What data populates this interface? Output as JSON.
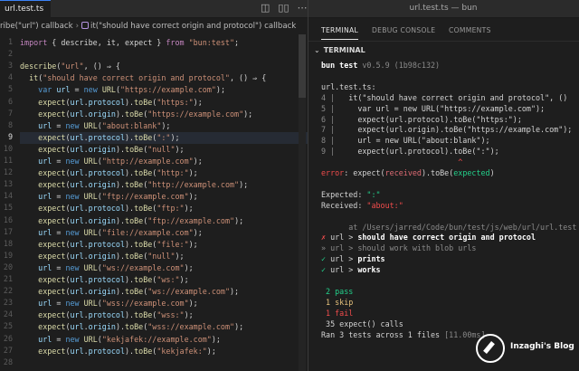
{
  "window": {
    "title": "url.test.ts — bun"
  },
  "editor": {
    "tab_label": "url.test.ts",
    "tab_actions": [
      "◫",
      "▯▯",
      "⋯"
    ],
    "breadcrumb": [
      "ribe(\"url\") callback",
      "it(\"should have correct origin and protocol\") callback"
    ],
    "active_line": 9,
    "line_numbers": [
      "1",
      "2",
      "3",
      "4",
      "5",
      "6",
      "7",
      "8",
      "9",
      "10",
      "11",
      "12",
      "13",
      "14",
      "15",
      "16",
      "17",
      "18",
      "19",
      "20",
      "21",
      "22",
      "23",
      "24",
      "25",
      "26",
      "27",
      "28"
    ],
    "lines": [
      [
        [
          "k",
          "import"
        ],
        [
          "p",
          " { describe, it, expect } "
        ],
        [
          "k",
          "from"
        ],
        [
          "p",
          " "
        ],
        [
          "s",
          "\"bun:test\""
        ],
        [
          "p",
          ";"
        ]
      ],
      [],
      [
        [
          "f",
          "describe"
        ],
        [
          "p",
          "("
        ],
        [
          "s",
          "\"url\""
        ],
        [
          "p",
          ", () ⇒ {"
        ]
      ],
      [
        [
          "p",
          "  "
        ],
        [
          "f",
          "it"
        ],
        [
          "p",
          "("
        ],
        [
          "s",
          "\"should have correct origin and protocol\""
        ],
        [
          "p",
          ", () ⇒ {"
        ]
      ],
      [
        [
          "p",
          "    "
        ],
        [
          "kb",
          "var"
        ],
        [
          "p",
          " "
        ],
        [
          "v",
          "url"
        ],
        [
          "p",
          " = "
        ],
        [
          "kb",
          "new"
        ],
        [
          "p",
          " "
        ],
        [
          "f",
          "URL"
        ],
        [
          "p",
          "("
        ],
        [
          "s",
          "\"https://example.com\""
        ],
        [
          "p",
          ");"
        ]
      ],
      [
        [
          "p",
          "    "
        ],
        [
          "f",
          "expect"
        ],
        [
          "p",
          "("
        ],
        [
          "v",
          "url"
        ],
        [
          "p",
          "."
        ],
        [
          "v",
          "protocol"
        ],
        [
          "p",
          ")."
        ],
        [
          "f",
          "toBe"
        ],
        [
          "p",
          "("
        ],
        [
          "s",
          "\"https:\""
        ],
        [
          "p",
          ");"
        ]
      ],
      [
        [
          "p",
          "    "
        ],
        [
          "f",
          "expect"
        ],
        [
          "p",
          "("
        ],
        [
          "v",
          "url"
        ],
        [
          "p",
          "."
        ],
        [
          "v",
          "origin"
        ],
        [
          "p",
          ")."
        ],
        [
          "f",
          "toBe"
        ],
        [
          "p",
          "("
        ],
        [
          "s",
          "\"https://example.com\""
        ],
        [
          "p",
          ");"
        ]
      ],
      [
        [
          "p",
          "    "
        ],
        [
          "v",
          "url"
        ],
        [
          "p",
          " = "
        ],
        [
          "kb",
          "new"
        ],
        [
          "p",
          " "
        ],
        [
          "f",
          "URL"
        ],
        [
          "p",
          "("
        ],
        [
          "s",
          "\"about:blank\""
        ],
        [
          "p",
          ");"
        ]
      ],
      [
        [
          "p",
          "    "
        ],
        [
          "f",
          "expect"
        ],
        [
          "p",
          "("
        ],
        [
          "v",
          "url"
        ],
        [
          "p",
          "."
        ],
        [
          "v",
          "protocol"
        ],
        [
          "p",
          ")."
        ],
        [
          "f",
          "toBe"
        ],
        [
          "p",
          "("
        ],
        [
          "s",
          "\":\""
        ],
        [
          "p",
          ");"
        ]
      ],
      [
        [
          "p",
          "    "
        ],
        [
          "f",
          "expect"
        ],
        [
          "p",
          "("
        ],
        [
          "v",
          "url"
        ],
        [
          "p",
          "."
        ],
        [
          "v",
          "origin"
        ],
        [
          "p",
          ")."
        ],
        [
          "f",
          "toBe"
        ],
        [
          "p",
          "("
        ],
        [
          "s",
          "\"null\""
        ],
        [
          "p",
          ");"
        ]
      ],
      [
        [
          "p",
          "    "
        ],
        [
          "v",
          "url"
        ],
        [
          "p",
          " = "
        ],
        [
          "kb",
          "new"
        ],
        [
          "p",
          " "
        ],
        [
          "f",
          "URL"
        ],
        [
          "p",
          "("
        ],
        [
          "s",
          "\"http://example.com\""
        ],
        [
          "p",
          ");"
        ]
      ],
      [
        [
          "p",
          "    "
        ],
        [
          "f",
          "expect"
        ],
        [
          "p",
          "("
        ],
        [
          "v",
          "url"
        ],
        [
          "p",
          "."
        ],
        [
          "v",
          "protocol"
        ],
        [
          "p",
          ")."
        ],
        [
          "f",
          "toBe"
        ],
        [
          "p",
          "("
        ],
        [
          "s",
          "\"http:\""
        ],
        [
          "p",
          ");"
        ]
      ],
      [
        [
          "p",
          "    "
        ],
        [
          "f",
          "expect"
        ],
        [
          "p",
          "("
        ],
        [
          "v",
          "url"
        ],
        [
          "p",
          "."
        ],
        [
          "v",
          "origin"
        ],
        [
          "p",
          ")."
        ],
        [
          "f",
          "toBe"
        ],
        [
          "p",
          "("
        ],
        [
          "s",
          "\"http://example.com\""
        ],
        [
          "p",
          ");"
        ]
      ],
      [
        [
          "p",
          "    "
        ],
        [
          "v",
          "url"
        ],
        [
          "p",
          " = "
        ],
        [
          "kb",
          "new"
        ],
        [
          "p",
          " "
        ],
        [
          "f",
          "URL"
        ],
        [
          "p",
          "("
        ],
        [
          "s",
          "\"ftp://example.com\""
        ],
        [
          "p",
          ");"
        ]
      ],
      [
        [
          "p",
          "    "
        ],
        [
          "f",
          "expect"
        ],
        [
          "p",
          "("
        ],
        [
          "v",
          "url"
        ],
        [
          "p",
          "."
        ],
        [
          "v",
          "protocol"
        ],
        [
          "p",
          ")."
        ],
        [
          "f",
          "toBe"
        ],
        [
          "p",
          "("
        ],
        [
          "s",
          "\"ftp:\""
        ],
        [
          "p",
          ");"
        ]
      ],
      [
        [
          "p",
          "    "
        ],
        [
          "f",
          "expect"
        ],
        [
          "p",
          "("
        ],
        [
          "v",
          "url"
        ],
        [
          "p",
          "."
        ],
        [
          "v",
          "origin"
        ],
        [
          "p",
          ")."
        ],
        [
          "f",
          "toBe"
        ],
        [
          "p",
          "("
        ],
        [
          "s",
          "\"ftp://example.com\""
        ],
        [
          "p",
          ");"
        ]
      ],
      [
        [
          "p",
          "    "
        ],
        [
          "v",
          "url"
        ],
        [
          "p",
          " = "
        ],
        [
          "kb",
          "new"
        ],
        [
          "p",
          " "
        ],
        [
          "f",
          "URL"
        ],
        [
          "p",
          "("
        ],
        [
          "s",
          "\"file://example.com\""
        ],
        [
          "p",
          ");"
        ]
      ],
      [
        [
          "p",
          "    "
        ],
        [
          "f",
          "expect"
        ],
        [
          "p",
          "("
        ],
        [
          "v",
          "url"
        ],
        [
          "p",
          "."
        ],
        [
          "v",
          "protocol"
        ],
        [
          "p",
          ")."
        ],
        [
          "f",
          "toBe"
        ],
        [
          "p",
          "("
        ],
        [
          "s",
          "\"file:\""
        ],
        [
          "p",
          ");"
        ]
      ],
      [
        [
          "p",
          "    "
        ],
        [
          "f",
          "expect"
        ],
        [
          "p",
          "("
        ],
        [
          "v",
          "url"
        ],
        [
          "p",
          "."
        ],
        [
          "v",
          "origin"
        ],
        [
          "p",
          ")."
        ],
        [
          "f",
          "toBe"
        ],
        [
          "p",
          "("
        ],
        [
          "s",
          "\"null\""
        ],
        [
          "p",
          ");"
        ]
      ],
      [
        [
          "p",
          "    "
        ],
        [
          "v",
          "url"
        ],
        [
          "p",
          " = "
        ],
        [
          "kb",
          "new"
        ],
        [
          "p",
          " "
        ],
        [
          "f",
          "URL"
        ],
        [
          "p",
          "("
        ],
        [
          "s",
          "\"ws://example.com\""
        ],
        [
          "p",
          ");"
        ]
      ],
      [
        [
          "p",
          "    "
        ],
        [
          "f",
          "expect"
        ],
        [
          "p",
          "("
        ],
        [
          "v",
          "url"
        ],
        [
          "p",
          "."
        ],
        [
          "v",
          "protocol"
        ],
        [
          "p",
          ")."
        ],
        [
          "f",
          "toBe"
        ],
        [
          "p",
          "("
        ],
        [
          "s",
          "\"ws:\""
        ],
        [
          "p",
          ");"
        ]
      ],
      [
        [
          "p",
          "    "
        ],
        [
          "f",
          "expect"
        ],
        [
          "p",
          "("
        ],
        [
          "v",
          "url"
        ],
        [
          "p",
          "."
        ],
        [
          "v",
          "origin"
        ],
        [
          "p",
          ")."
        ],
        [
          "f",
          "toBe"
        ],
        [
          "p",
          "("
        ],
        [
          "s",
          "\"ws://example.com\""
        ],
        [
          "p",
          ");"
        ]
      ],
      [
        [
          "p",
          "    "
        ],
        [
          "v",
          "url"
        ],
        [
          "p",
          " = "
        ],
        [
          "kb",
          "new"
        ],
        [
          "p",
          " "
        ],
        [
          "f",
          "URL"
        ],
        [
          "p",
          "("
        ],
        [
          "s",
          "\"wss://example.com\""
        ],
        [
          "p",
          ");"
        ]
      ],
      [
        [
          "p",
          "    "
        ],
        [
          "f",
          "expect"
        ],
        [
          "p",
          "("
        ],
        [
          "v",
          "url"
        ],
        [
          "p",
          "."
        ],
        [
          "v",
          "protocol"
        ],
        [
          "p",
          ")."
        ],
        [
          "f",
          "toBe"
        ],
        [
          "p",
          "("
        ],
        [
          "s",
          "\"wss:\""
        ],
        [
          "p",
          ");"
        ]
      ],
      [
        [
          "p",
          "    "
        ],
        [
          "f",
          "expect"
        ],
        [
          "p",
          "("
        ],
        [
          "v",
          "url"
        ],
        [
          "p",
          "."
        ],
        [
          "v",
          "origin"
        ],
        [
          "p",
          ")."
        ],
        [
          "f",
          "toBe"
        ],
        [
          "p",
          "("
        ],
        [
          "s",
          "\"wss://example.com\""
        ],
        [
          "p",
          ");"
        ]
      ],
      [
        [
          "p",
          "    "
        ],
        [
          "v",
          "url"
        ],
        [
          "p",
          " = "
        ],
        [
          "kb",
          "new"
        ],
        [
          "p",
          " "
        ],
        [
          "f",
          "URL"
        ],
        [
          "p",
          "("
        ],
        [
          "s",
          "\"kekjafek://example.com\""
        ],
        [
          "p",
          ");"
        ]
      ],
      [
        [
          "p",
          "    "
        ],
        [
          "f",
          "expect"
        ],
        [
          "p",
          "("
        ],
        [
          "v",
          "url"
        ],
        [
          "p",
          "."
        ],
        [
          "v",
          "protocol"
        ],
        [
          "p",
          ")."
        ],
        [
          "f",
          "toBe"
        ],
        [
          "p",
          "("
        ],
        [
          "s",
          "\"kekjafek:\""
        ],
        [
          "p",
          ");"
        ]
      ],
      []
    ]
  },
  "panel": {
    "tabs": [
      "TERMINAL",
      "DEBUG CONSOLE",
      "COMMENTS"
    ],
    "section_title": "TERMINAL",
    "terminal_lines": [
      [
        [
          "b",
          "bun test"
        ],
        [
          "dim",
          " v0.5.9 (1b98c132)"
        ]
      ],
      [],
      [
        [
          "p",
          "url.test.ts:"
        ]
      ],
      [
        [
          "dim",
          "4 | "
        ],
        [
          "p",
          "  it(\"should have correct origin and protocol\", ()"
        ]
      ],
      [
        [
          "dim",
          "5 | "
        ],
        [
          "p",
          "    var url = new URL(\"https://example.com\");"
        ]
      ],
      [
        [
          "dim",
          "6 | "
        ],
        [
          "p",
          "    expect(url.protocol).toBe(\"https:\");"
        ]
      ],
      [
        [
          "dim",
          "7 | "
        ],
        [
          "p",
          "    expect(url.origin).toBe(\"https://example.com\");"
        ]
      ],
      [
        [
          "dim",
          "8 | "
        ],
        [
          "p",
          "    url = new URL(\"about:blank\");"
        ]
      ],
      [
        [
          "dim",
          "9 | "
        ],
        [
          "p",
          "    expect(url.protocol).toBe(\":\");"
        ]
      ],
      [
        [
          "p",
          "                              "
        ],
        [
          "red",
          "^"
        ]
      ],
      [
        [
          "red",
          "error"
        ],
        [
          "p",
          ": expect("
        ],
        [
          "c-red",
          "received"
        ],
        [
          "p",
          ").toBe("
        ],
        [
          "grn",
          "expected"
        ],
        [
          "p",
          ")"
        ]
      ],
      [],
      [
        [
          "p",
          "Expected: "
        ],
        [
          "grn",
          "\":\""
        ]
      ],
      [
        [
          "p",
          "Received: "
        ],
        [
          "red",
          "\"about:\""
        ]
      ],
      [],
      [
        [
          "dim",
          "      at /Users/jarred/Code/bun/test/js/web/url/url.test"
        ]
      ],
      [
        [
          "red",
          "✗"
        ],
        [
          "p",
          " url > "
        ],
        [
          "b",
          "should have correct origin and protocol"
        ]
      ],
      [
        [
          "dim",
          "» url > should work with blob urls"
        ]
      ],
      [
        [
          "grn",
          "✓"
        ],
        [
          "p",
          " url > "
        ],
        [
          "b",
          "prints"
        ]
      ],
      [
        [
          "grn",
          "✓"
        ],
        [
          "p",
          " url > "
        ],
        [
          "b",
          "works"
        ]
      ],
      [],
      [
        [
          "grn",
          " 2 pass"
        ]
      ],
      [
        [
          "yel",
          " 1 skip"
        ]
      ],
      [
        [
          "red",
          " 1 fail"
        ]
      ],
      [
        [
          "p",
          " 35 expect() calls"
        ]
      ],
      [
        [
          "p",
          "Ran 3 tests across 1 files "
        ],
        [
          "dim",
          "[11.00ms]"
        ]
      ]
    ]
  },
  "brand": {
    "name": "Inzaghi's Blog"
  }
}
